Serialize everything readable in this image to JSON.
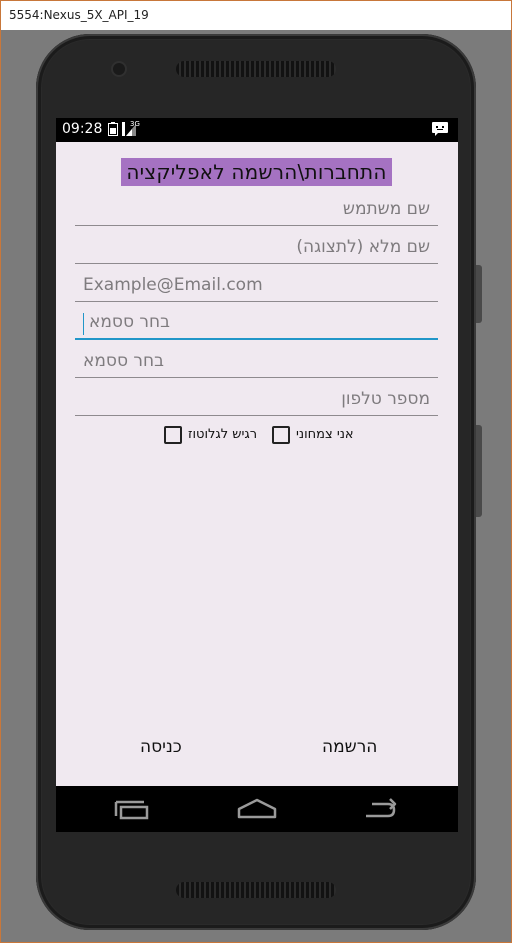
{
  "window": {
    "title": "5554:Nexus_5X_API_19"
  },
  "status_bar": {
    "time": "09:28",
    "network": "3G"
  },
  "app": {
    "title": "התחברות\\הרשמה לאפליקציה",
    "fields": [
      {
        "name": "username",
        "placeholder": "שם משתמש"
      },
      {
        "name": "full_name",
        "placeholder": "שם מלא (לתצוגה)"
      },
      {
        "name": "email",
        "placeholder": "Example@Email.com"
      },
      {
        "name": "password",
        "placeholder": "בחר  ססמא"
      },
      {
        "name": "password_confirm",
        "placeholder": "בחר  ססמא"
      },
      {
        "name": "phone",
        "placeholder": "מספר טלפון"
      }
    ],
    "checkboxes": [
      {
        "label": "אני צמחוני",
        "checked": false
      },
      {
        "label": "רגיש לגלוטוז",
        "checked": false
      }
    ],
    "register_label": "הרשמה",
    "login_label": "כניסה"
  },
  "nav_bar": {
    "icons": [
      "recent-apps-icon",
      "home-icon",
      "back-icon"
    ]
  }
}
